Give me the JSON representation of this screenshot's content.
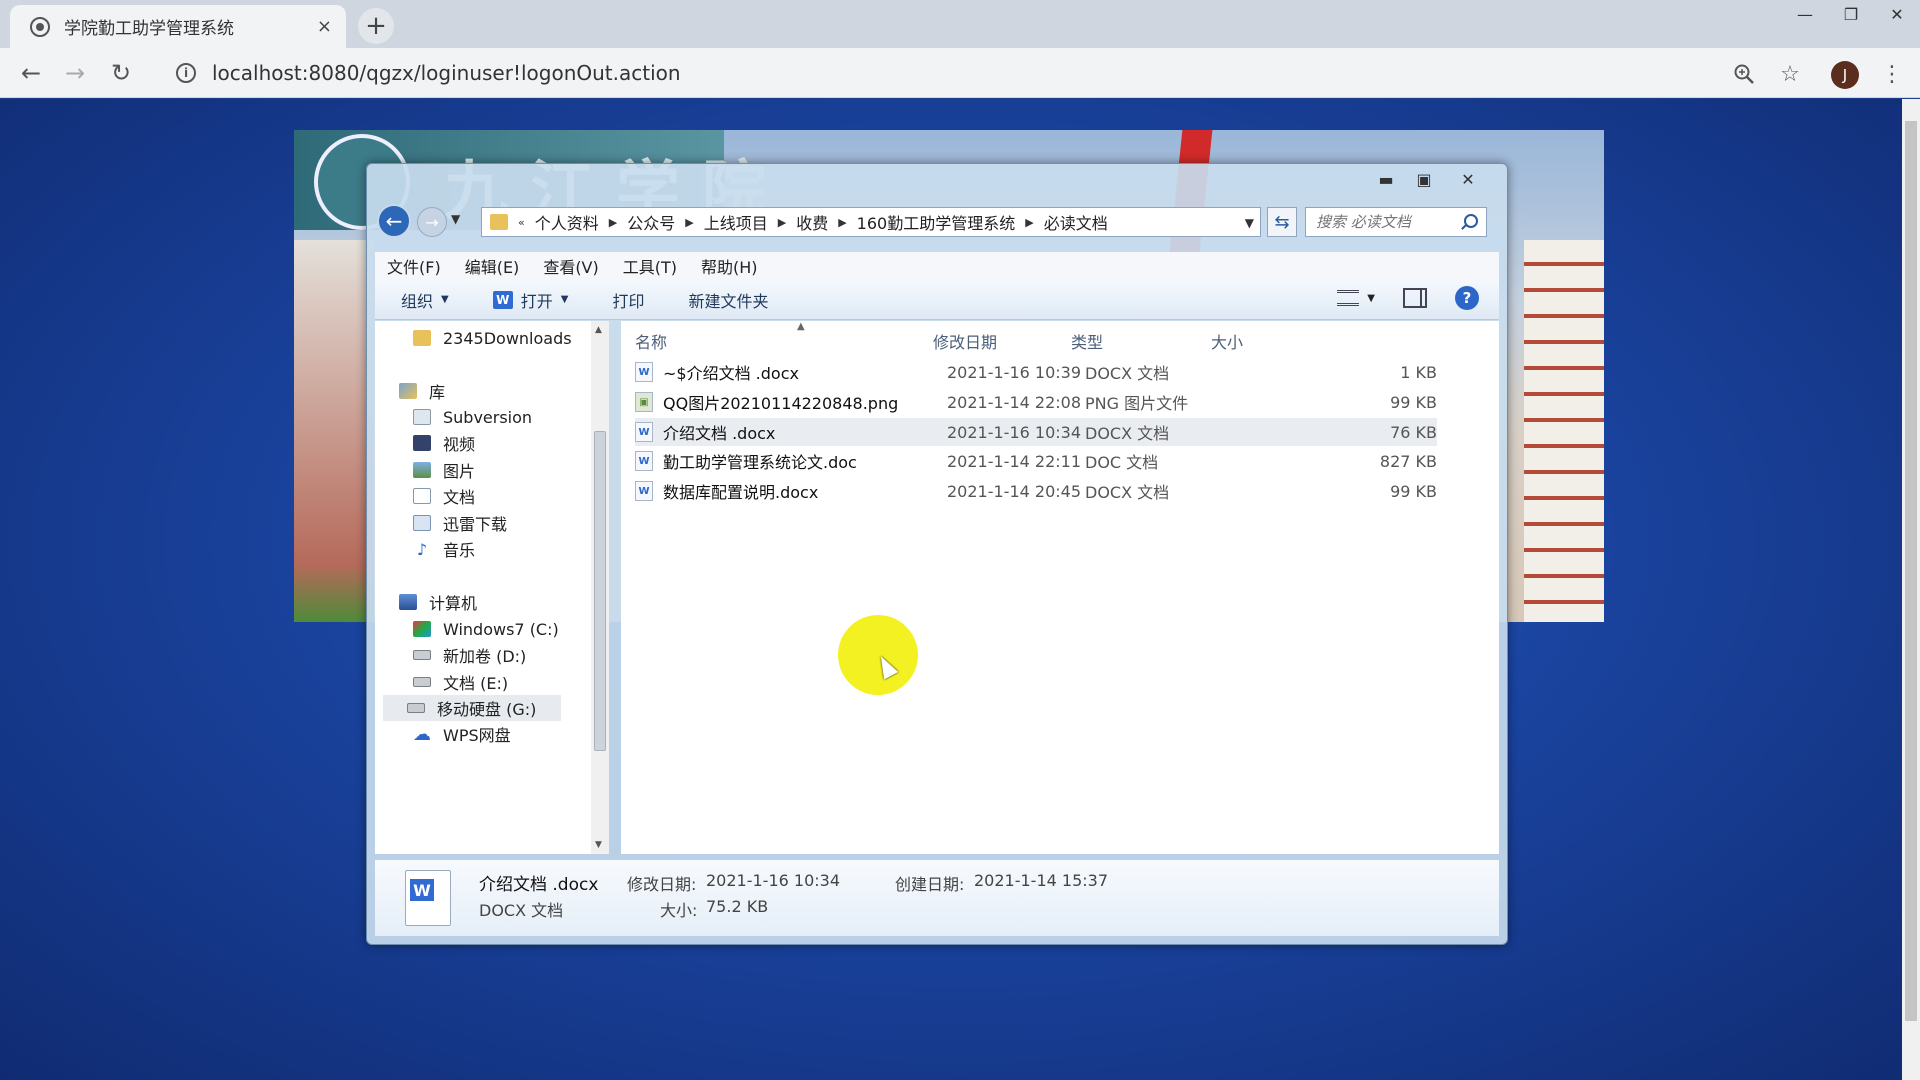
{
  "browser": {
    "tab_title": "学院勤工助学管理系统",
    "tab_close": "×",
    "new_tab": "+",
    "url": "localhost:8080/qgzx/loginuser!logonOut.action",
    "back": "←",
    "forward": "→",
    "reload": "↻",
    "profile_initial": "J",
    "window_controls": {
      "minimize": "—",
      "restore": "❐",
      "close": "✕"
    },
    "icons": {
      "zoom": "search-icon",
      "bookmark": "star-icon",
      "menu": "kebab-menu-icon"
    }
  },
  "banner": {
    "school_name": "九江学院"
  },
  "explorer": {
    "caption": {
      "minimize": "▬",
      "restore": "▣",
      "close": "✕"
    },
    "breadcrumb_lead": "«",
    "breadcrumbs": [
      "个人资料",
      "公众号",
      "上线项目",
      "收费",
      "160勤工助学管理系统",
      "必读文档"
    ],
    "search_placeholder": "搜索 必读文档",
    "menu": [
      "文件(F)",
      "编辑(E)",
      "查看(V)",
      "工具(T)",
      "帮助(H)"
    ],
    "commands": {
      "organize": "组织",
      "open": "打开",
      "print": "打印",
      "new_folder": "新建文件夹"
    },
    "nav": {
      "top_folder": "2345Downloads",
      "libraries": "库",
      "library_items": [
        "Subversion",
        "视频",
        "图片",
        "文档",
        "迅雷下载",
        "音乐"
      ],
      "computer": "计算机",
      "drives": [
        "Windows7 (C:)",
        "新加卷 (D:)",
        "文档 (E:)",
        "移动硬盘 (G:)"
      ],
      "cloud": "WPS网盘"
    },
    "columns": {
      "name": "名称",
      "modified": "修改日期",
      "type": "类型",
      "size": "大小"
    },
    "files": [
      {
        "icon": "docx",
        "name": "~$介绍文档 .docx",
        "modified": "2021-1-16 10:39",
        "type": "DOCX 文档",
        "size": "1 KB"
      },
      {
        "icon": "png",
        "name": "QQ图片20210114220848.png",
        "modified": "2021-1-14 22:08",
        "type": "PNG 图片文件",
        "size": "99 KB"
      },
      {
        "icon": "docx",
        "name": "介绍文档 .docx",
        "modified": "2021-1-16 10:34",
        "type": "DOCX 文档",
        "size": "76 KB",
        "selected": true
      },
      {
        "icon": "doc",
        "name": "勤工助学管理系统论文.doc",
        "modified": "2021-1-14 22:11",
        "type": "DOC 文档",
        "size": "827 KB"
      },
      {
        "icon": "docx",
        "name": "数据库配置说明.docx",
        "modified": "2021-1-14 20:45",
        "type": "DOCX 文档",
        "size": "99 KB"
      }
    ],
    "details": {
      "name": "介绍文档 .docx",
      "modified_label": "修改日期:",
      "modified": "2021-1-16 10:34",
      "created_label": "创建日期:",
      "created": "2021-1-14 15:37",
      "type": "DOCX 文档",
      "size_label": "大小:",
      "size": "75.2 KB"
    }
  },
  "colors": {
    "page_bg": "#1b3f8f",
    "cursor_highlight": "#f3f016",
    "selection": "#e9edf2"
  }
}
